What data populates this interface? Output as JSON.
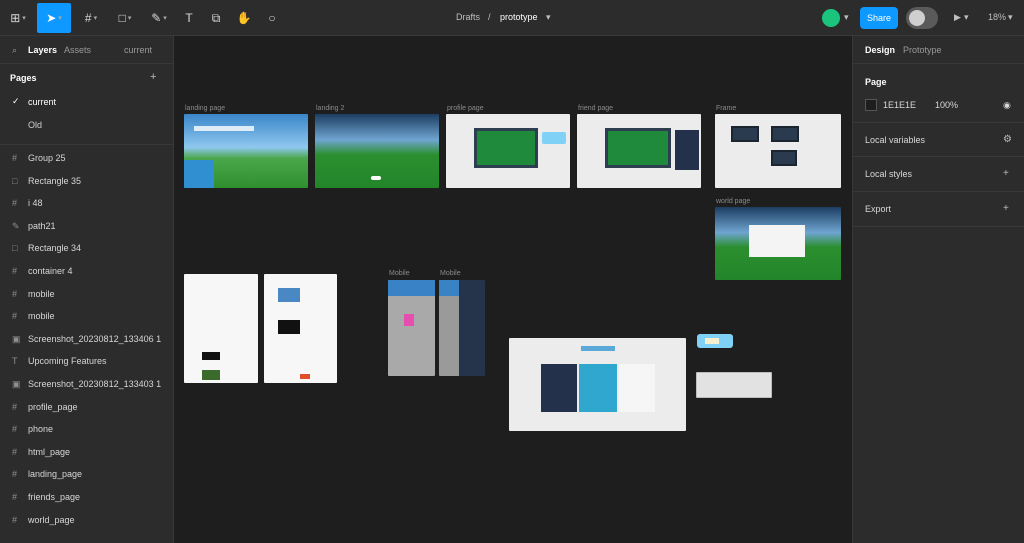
{
  "toolbar": {
    "breadcrumb_project": "Drafts",
    "breadcrumb_file": "prototype",
    "share_label": "Share",
    "zoom": "18%",
    "play_label": "▶"
  },
  "left_panel": {
    "tabs": [
      "Layers",
      "Assets",
      "current"
    ],
    "pages_title": "Pages",
    "pages": [
      "current",
      "Old"
    ],
    "layers": [
      "Group 25",
      "Rectangle 35",
      "i 48",
      "path21",
      "Rectangle 34",
      "container 4",
      "mobile",
      "mobile",
      "Screenshot_20230812_133406 1",
      "Upcoming Features",
      "Screenshot_20230812_133403 1",
      "profile_page",
      "phone",
      "html_page",
      "landing_page",
      "friends_page",
      "world_page"
    ]
  },
  "canvas": {
    "frame_labels": [
      "landing page",
      "landing 2",
      "profile page",
      "friend page",
      "Frame",
      "world page",
      "",
      "",
      "Mobile",
      "Mobile"
    ]
  },
  "right_panel": {
    "tabs": [
      "Design",
      "Prototype"
    ],
    "page_title": "Page",
    "bg_hex": "1E1E1E",
    "bg_opacity": "100%",
    "sections": [
      "Local variables",
      "Local styles",
      "Export"
    ]
  }
}
